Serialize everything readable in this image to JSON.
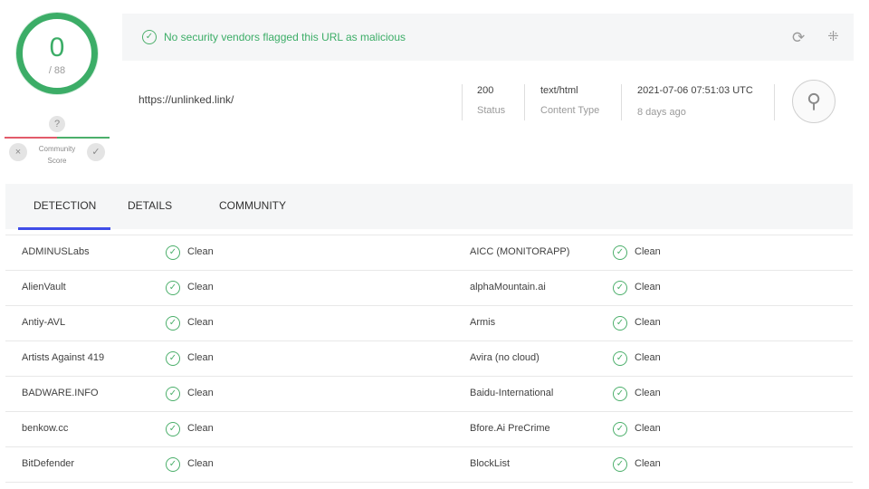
{
  "score": {
    "detected": "0",
    "total": "/ 88"
  },
  "community": {
    "question": "?",
    "label_line1": "Community",
    "label_line2": "Score",
    "down": "×",
    "up": "✓"
  },
  "summary": {
    "message": "No security vendors flagged this URL as malicious",
    "url": "https://unlinked.link/",
    "status_value": "200",
    "status_label": "Status",
    "content_type_value": "text/html",
    "content_type_label": "Content Type",
    "date": "2021-07-06 07:51:03 UTC",
    "age": "8 days ago"
  },
  "icons": {
    "check": "✓",
    "reload": "⟳",
    "graph": "⁜",
    "favicon": "⚲"
  },
  "tabs": [
    {
      "label": "DETECTION",
      "active": true
    },
    {
      "label": "DETAILS",
      "active": false
    },
    {
      "label": "COMMUNITY",
      "active": false
    }
  ],
  "results": [
    {
      "left_engine": "ADMINUSLabs",
      "left_result": "Clean",
      "right_engine": "AICC (MONITORAPP)",
      "right_result": "Clean"
    },
    {
      "left_engine": "AlienVault",
      "left_result": "Clean",
      "right_engine": "alphaMountain.ai",
      "right_result": "Clean"
    },
    {
      "left_engine": "Antiy-AVL",
      "left_result": "Clean",
      "right_engine": "Armis",
      "right_result": "Clean"
    },
    {
      "left_engine": "Artists Against 419",
      "left_result": "Clean",
      "right_engine": "Avira (no cloud)",
      "right_result": "Clean"
    },
    {
      "left_engine": "BADWARE.INFO",
      "left_result": "Clean",
      "right_engine": "Baidu-International",
      "right_result": "Clean"
    },
    {
      "left_engine": "benkow.cc",
      "left_result": "Clean",
      "right_engine": "Bfore.Ai PreCrime",
      "right_result": "Clean"
    },
    {
      "left_engine": "BitDefender",
      "left_result": "Clean",
      "right_engine": "BlockList",
      "right_result": "Clean"
    }
  ],
  "colors": {
    "clean_green": "#4caf6b",
    "score_green": "#3cad67",
    "tab_underline": "#3f4de8",
    "community_red": "#e25b6a"
  }
}
